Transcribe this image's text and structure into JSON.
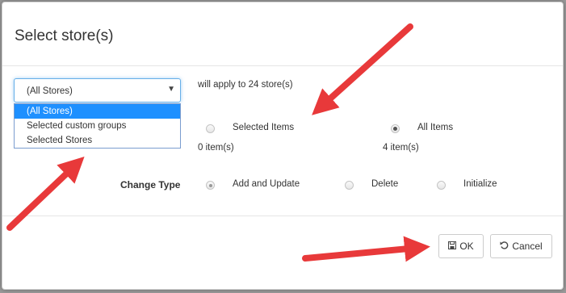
{
  "modal": {
    "title": "Select store(s)"
  },
  "store_select": {
    "value": "(All Stores)",
    "options": [
      "(All Stores)",
      "Selected custom groups",
      "Selected Stores"
    ],
    "selected_index": 0,
    "caret_icon": "caret-down-icon"
  },
  "apply_note": "will apply to 24 store(s)",
  "items": {
    "selected": {
      "label": "Selected Items",
      "count": "0 item(s)",
      "checked": false
    },
    "all": {
      "label": "All Items",
      "count": "4 item(s)",
      "checked": true
    }
  },
  "change_type": {
    "label": "Change Type",
    "options": [
      {
        "label": "Add and Update",
        "checked": true
      },
      {
        "label": "Delete",
        "checked": false
      },
      {
        "label": "Initialize",
        "checked": false
      }
    ]
  },
  "footer": {
    "ok_label": "OK",
    "cancel_label": "Cancel",
    "ok_icon": "save-icon",
    "cancel_icon": "undo-icon"
  },
  "annotation_color": "#e8393a"
}
